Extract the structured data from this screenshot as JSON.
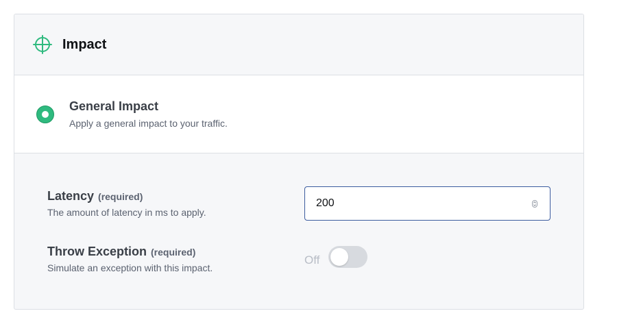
{
  "panel": {
    "title": "Impact",
    "icon": "crosshair-icon",
    "accent_color": "#2fba7f"
  },
  "impact_option": {
    "title": "General Impact",
    "description": "Apply a general impact to your traffic.",
    "selected": true
  },
  "fields": {
    "latency": {
      "label": "Latency",
      "required_tag": "(required)",
      "description": "The amount of latency in ms to apply.",
      "value": "200"
    },
    "throw_exception": {
      "label": "Throw Exception",
      "required_tag": "(required)",
      "description": "Simulate an exception with this impact.",
      "state_text": "Off",
      "enabled": false
    }
  }
}
